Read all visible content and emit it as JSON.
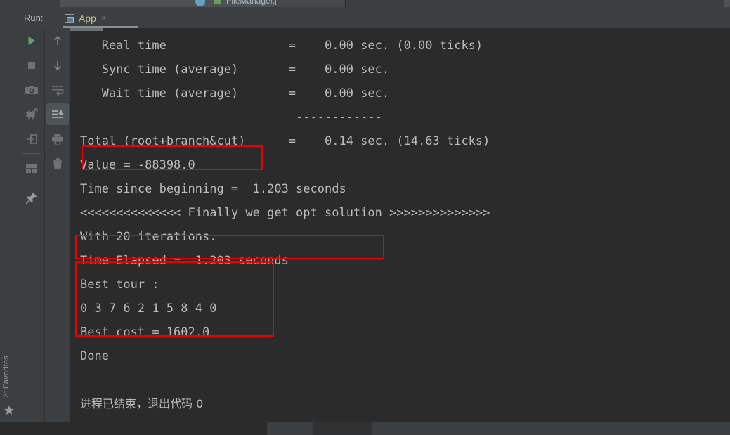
{
  "window": {
    "editor_tab_clipped_label": "FileManager.ja"
  },
  "run_panel": {
    "label": "Run:",
    "tab_name": "App",
    "tab_close_label": "×",
    "tab_icon": "run-configuration-icon"
  },
  "favorites_bar": {
    "label": "2: Favorites",
    "icon": "star-icon"
  },
  "toolbar": {
    "left_column": [
      {
        "name": "rerun-button",
        "icon": "play-icon",
        "selected": false
      },
      {
        "name": "stop-button",
        "icon": "stop-square-icon",
        "selected": false
      },
      {
        "name": "dump-threads-button",
        "icon": "camera-icon",
        "selected": false
      },
      {
        "name": "restore-layout-button",
        "icon": "bug-arrow-icon",
        "selected": false
      },
      {
        "name": "console-button",
        "icon": "export-arrow-icon",
        "selected": false
      },
      {
        "name": "layout-button",
        "icon": "panels-icon",
        "selected": false
      },
      {
        "name": "pin-tab-button",
        "icon": "pin-icon",
        "selected": false
      }
    ],
    "right_column": [
      {
        "name": "up-stack-button",
        "icon": "arrow-up-icon",
        "selected": false
      },
      {
        "name": "down-stack-button",
        "icon": "arrow-down-icon",
        "selected": false
      },
      {
        "name": "soft-wrap-button",
        "icon": "soft-wrap-icon",
        "selected": false
      },
      {
        "name": "scroll-to-end-button",
        "icon": "scroll-to-end-icon",
        "selected": true
      },
      {
        "name": "print-button",
        "icon": "printer-icon",
        "selected": false
      },
      {
        "name": "clear-all-button",
        "icon": "trash-icon",
        "selected": false
      }
    ]
  },
  "console": {
    "lines": [
      "   Real time                 =    0.00 sec. (0.00 ticks)",
      "   Sync time (average)       =    0.00 sec.",
      "   Wait time (average)       =    0.00 sec.",
      "                              ------------",
      "Total (root+branch&cut)      =    0.14 sec. (14.63 ticks)",
      "Value = -88398.0",
      "Time since beginning =  1.203 seconds",
      "<<<<<<<<<<<<<< Finally we get opt solution >>>>>>>>>>>>>>",
      "With 20 iterations.",
      "Time Elapsed =  1.203 seconds",
      "Best tour :",
      "0 3 7 6 2 1 5 8 4 0",
      "Best cost = 1602.0",
      "Done",
      "",
      "进程已结束，退出代码 0"
    ],
    "chinese_line_index": 15,
    "blank_line_index": 14
  },
  "annotations": [
    {
      "name": "highlight-box-value",
      "target_line": "Value = -88398.0",
      "color": "#ee0000"
    },
    {
      "name": "highlight-box-elapsed",
      "target_line": "Time Elapsed =  1.203 seconds",
      "color": "#ee0000"
    },
    {
      "name": "highlight-box-best-tour",
      "target_line": "Best tour : / 0 3 7 6 2 1 5 8 4 0 / Best cost = 1602.0",
      "color": "#ee0000"
    }
  ],
  "colors": {
    "console_background": "#2b2b2b",
    "console_text": "#bbbbbb",
    "panel_background": "#3c3f41",
    "tab_text": "#c3bb9a",
    "annotation_red": "#ee0000",
    "run_green": "#59a869"
  }
}
